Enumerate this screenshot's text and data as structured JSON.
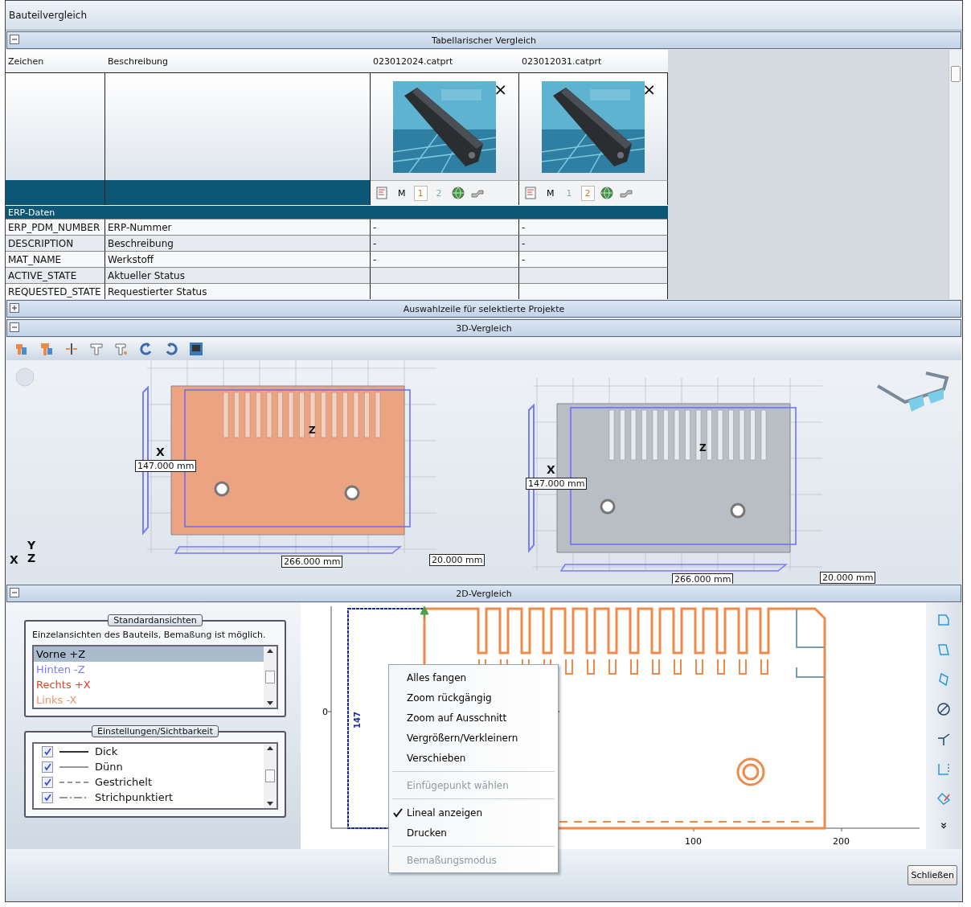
{
  "window": {
    "title": "Bauteilvergleich"
  },
  "table_section": {
    "title": "Tabellarischer Vergleich",
    "expanded": true,
    "columns": [
      "Zeichen",
      "Beschreibung",
      "023012024.catprt",
      "023012031.catprt"
    ],
    "parts": [
      {
        "close": "×",
        "mode": "M",
        "pages": [
          {
            "label": "1",
            "selected": true
          },
          {
            "label": "2",
            "selected": false
          }
        ]
      },
      {
        "close": "×",
        "mode": "M",
        "pages": [
          {
            "label": "1",
            "selected": false
          },
          {
            "label": "2",
            "selected": true
          }
        ]
      }
    ],
    "group": "ERP-Daten",
    "rows": [
      {
        "cells": [
          "ERP_PDM_NUMBER",
          "ERP-Nummer",
          "-",
          "-"
        ]
      },
      {
        "cells": [
          "DESCRIPTION",
          "Beschreibung",
          "-",
          "-"
        ]
      },
      {
        "cells": [
          "MAT_NAME",
          "Werkstoff",
          "-",
          "-"
        ]
      },
      {
        "cells": [
          "ACTIVE_STATE",
          "Aktueller Status",
          "",
          ""
        ]
      },
      {
        "cells": [
          "REQUESTED_STATE",
          "Requestierter Status",
          "",
          ""
        ]
      }
    ]
  },
  "selection_section": {
    "title": "Auswahlzeile für selektierte Projekte",
    "expanded": false
  },
  "view3d_section": {
    "title": "3D-Vergleich",
    "expanded": true,
    "models": [
      {
        "color": "#eba381",
        "x_label": "X",
        "z_label": "Z",
        "height": "147.000 mm",
        "length": "266.000 mm",
        "depth": "20.000 mm"
      },
      {
        "color": "#b9bec4",
        "x_label": "X",
        "z_label": "Z",
        "height": "147.000 mm",
        "length": "266.000 mm",
        "depth": "20.000 mm"
      }
    ],
    "triad": {
      "x": "X",
      "y": "Y",
      "z": "Z"
    }
  },
  "view2d_section": {
    "title": "2D-Vergleich",
    "expanded": true,
    "standard_views": {
      "title": "Standardansichten",
      "description": "Einzelansichten des Bauteils, Bemaßung ist möglich.",
      "items": [
        {
          "label": "Vorne +Z",
          "color": "#000000",
          "selected": true
        },
        {
          "label": "Hinten -Z",
          "color": "#7a7aff",
          "selected": false
        },
        {
          "label": "Rechts +X",
          "color": "#e8401c",
          "selected": false
        },
        {
          "label": "Links -X",
          "color": "#f0906a",
          "selected": false
        }
      ]
    },
    "visibility": {
      "title": "Einstellungen/Sichtbarkeit",
      "items": [
        {
          "label": "Dick",
          "kind": "thick",
          "checked": true
        },
        {
          "label": "Dünn",
          "kind": "thin",
          "checked": true
        },
        {
          "label": "Gestrichelt",
          "kind": "dashed",
          "checked": true
        },
        {
          "label": "Strichpunktiert",
          "kind": "dashdot",
          "checked": true
        }
      ]
    },
    "drawing": {
      "y_tick": "0",
      "x_ticks": [
        "100",
        "200"
      ],
      "dimension": "147"
    },
    "context_menu": [
      {
        "kind": "item",
        "label": "Alles fangen",
        "disabled": false,
        "checked": false
      },
      {
        "kind": "item",
        "label": "Zoom rückgängig",
        "disabled": false,
        "checked": false
      },
      {
        "kind": "item",
        "label": "Zoom auf Ausschnitt",
        "disabled": false,
        "checked": false
      },
      {
        "kind": "item",
        "label": "Vergrößern/Verkleinern",
        "disabled": false,
        "checked": false
      },
      {
        "kind": "item",
        "label": "Verschieben",
        "disabled": false,
        "checked": false
      },
      {
        "kind": "separator"
      },
      {
        "kind": "item",
        "label": "Einfügepunkt wählen",
        "disabled": true,
        "checked": false
      },
      {
        "kind": "separator"
      },
      {
        "kind": "item",
        "label": "Lineal anzeigen",
        "disabled": false,
        "checked": true
      },
      {
        "kind": "item",
        "label": "Drucken",
        "disabled": false,
        "checked": false
      },
      {
        "kind": "separator"
      },
      {
        "kind": "item",
        "label": "Bemaßungsmodus",
        "disabled": true,
        "checked": false
      }
    ]
  },
  "footer": {
    "close_button": "Schließen"
  }
}
